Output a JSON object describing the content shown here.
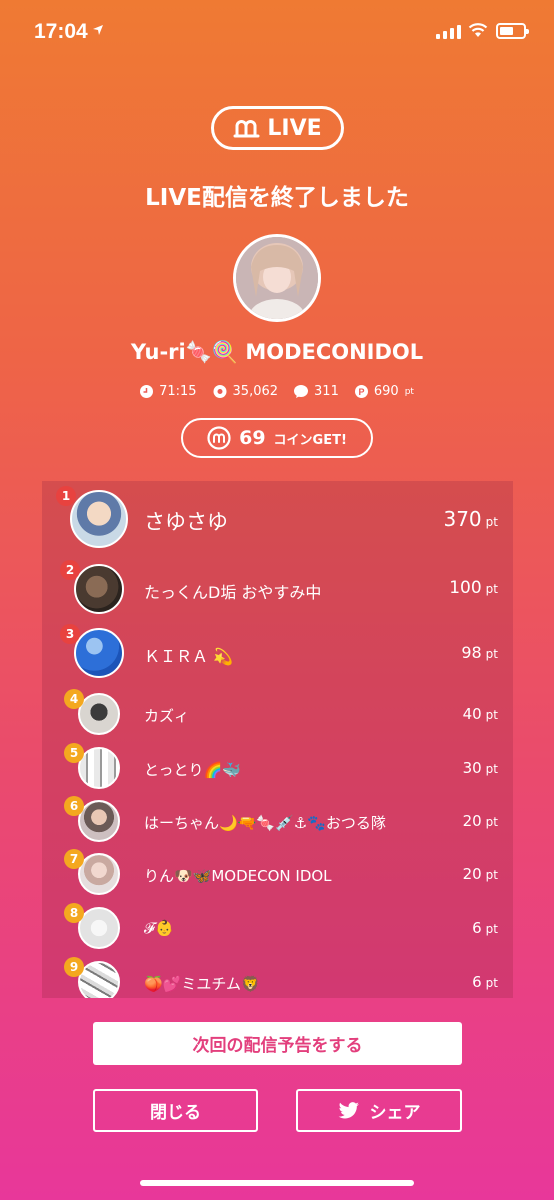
{
  "status_bar": {
    "time": "17:04"
  },
  "badge": {
    "label": "LIVE",
    "logo": "m-logo-icon"
  },
  "title": "LIVE配信を終了しました",
  "host": {
    "name": "Yu-ri🍬🍭 MODECONIDOL"
  },
  "stats": {
    "duration": "71:15",
    "viewers": "35,062",
    "comments": "311",
    "points": "690",
    "points_unit": "pt"
  },
  "coins": {
    "amount": "69",
    "suffix": "コインGET!"
  },
  "ranking": [
    {
      "rank": "1",
      "name": "さゆさゆ",
      "points": "370",
      "unit": "pt"
    },
    {
      "rank": "2",
      "name": "たっくんD垢 おやすみ中",
      "points": "100",
      "unit": "pt"
    },
    {
      "rank": "3",
      "name": "ＫＩＲＡ 💫",
      "points": "98",
      "unit": "pt"
    },
    {
      "rank": "4",
      "name": "カズィ",
      "points": "40",
      "unit": "pt"
    },
    {
      "rank": "5",
      "name": "とっとり🌈🐳",
      "points": "30",
      "unit": "pt"
    },
    {
      "rank": "6",
      "name": "はーちゃん🌙🔫🍬💉⚓🐾おつる隊",
      "points": "20",
      "unit": "pt"
    },
    {
      "rank": "7",
      "name": "りん🐶🦋MODECON IDOL",
      "points": "20",
      "unit": "pt"
    },
    {
      "rank": "8",
      "name": "𝓕👶",
      "points": "6",
      "unit": "pt"
    },
    {
      "rank": "9",
      "name": "🍑💕ミユチム🦁",
      "points": "6",
      "unit": "pt"
    }
  ],
  "buttons": {
    "schedule": "次回の配信予告をする",
    "close": "閉じる",
    "share": "シェア"
  },
  "colors": {
    "gradient_top": "#ef7a33",
    "gradient_bottom": "#e8379a",
    "rank_top": "#e8423f",
    "rank_other": "#f4a81f"
  }
}
